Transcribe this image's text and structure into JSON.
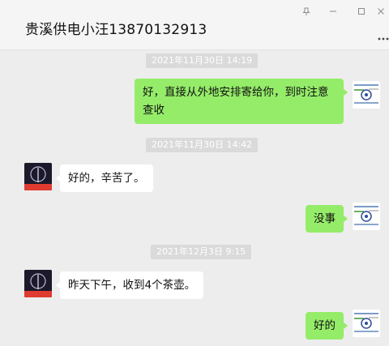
{
  "window": {
    "title": "贵溪供电小汪13870132913",
    "pin_icon": "pin-icon",
    "minimize_icon": "minimize-icon",
    "maximize_icon": "maximize-icon",
    "close_icon": "close-icon",
    "more_icon": "more-icon"
  },
  "messages": [
    {
      "type": "timestamp",
      "text": "2021年11月30日 14:19"
    },
    {
      "type": "sent",
      "text": "好，直接从外地安排寄给你，到时注意查收"
    },
    {
      "type": "timestamp",
      "text": "2021年11月30日 14:42"
    },
    {
      "type": "received",
      "text": "好的，辛苦了。"
    },
    {
      "type": "sent",
      "text": "没事"
    },
    {
      "type": "timestamp",
      "text": "2021年12月3日 9:15"
    },
    {
      "type": "received",
      "text": "昨天下午，收到4个茶壶。"
    },
    {
      "type": "sent",
      "text": "好的"
    }
  ],
  "colors": {
    "sent_bubble": "#95ec69",
    "received_bubble": "#ffffff",
    "background": "#ededed"
  }
}
